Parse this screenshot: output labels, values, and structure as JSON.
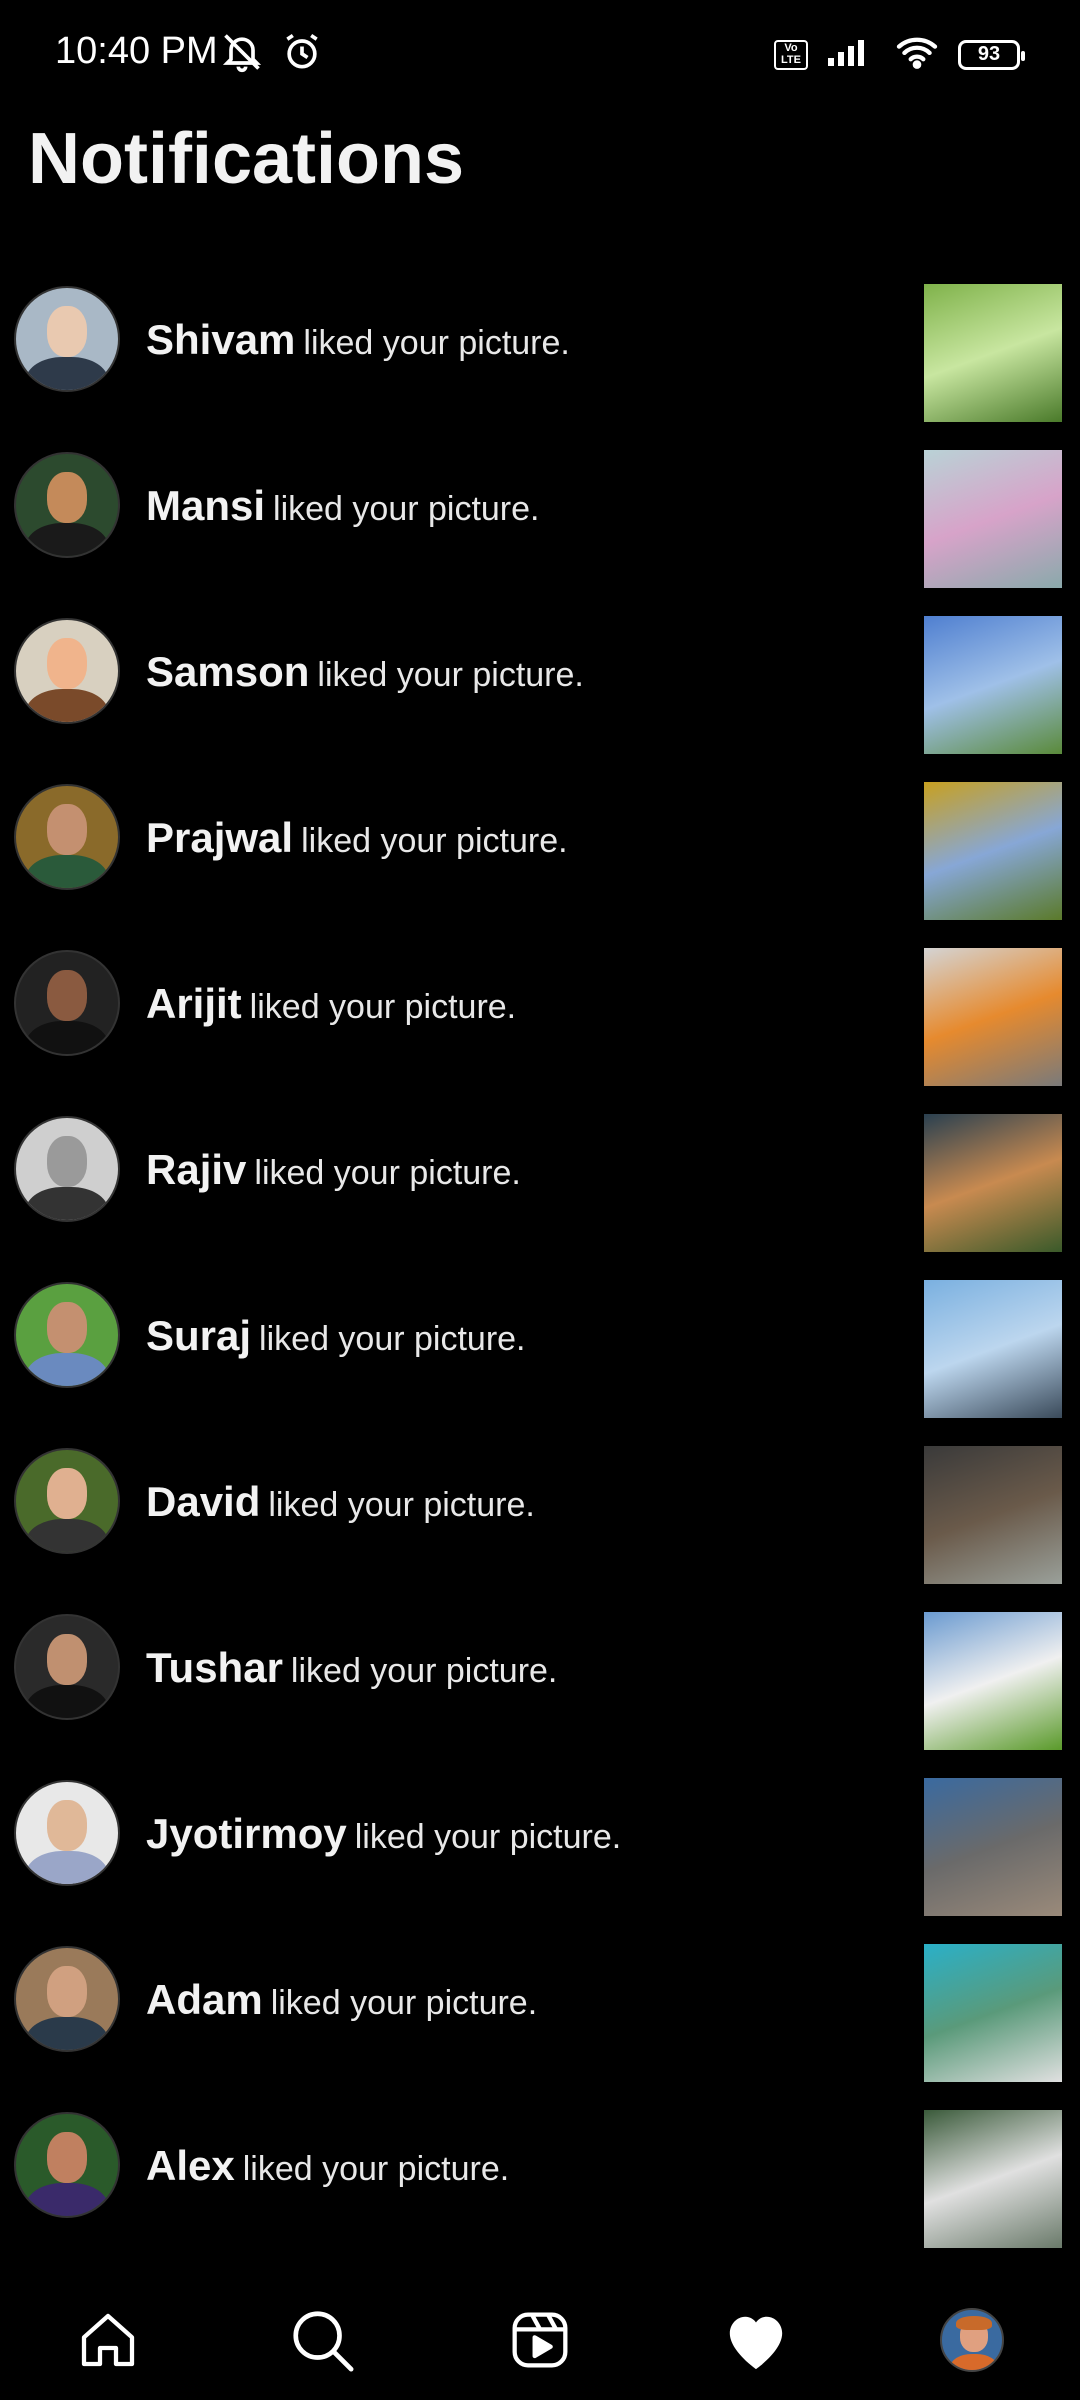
{
  "status_bar": {
    "time": "10:40 PM",
    "icons": [
      "bell-mute-icon",
      "alarm-icon"
    ],
    "right_icons": [
      "volte-icon",
      "signal-icon",
      "wifi-icon"
    ],
    "volte_label": "Vo LTE",
    "battery_level": "93"
  },
  "page": {
    "title": "Notifications"
  },
  "notification_suffix": "liked your picture.",
  "notifications": [
    {
      "name": "Shivam",
      "text": "liked your picture.",
      "avatar_colors": [
        "#a9b8c6",
        "#2e3a4a",
        "#e9c9b0"
      ],
      "thumb_colors": [
        "#7fb24a",
        "#c8e6a0",
        "#4a7a2a"
      ]
    },
    {
      "name": "Mansi",
      "text": "liked your picture.",
      "avatar_colors": [
        "#2c4a2e",
        "#1a1a1a",
        "#c48a5a"
      ],
      "thumb_colors": [
        "#b9d2d6",
        "#d7a3c9",
        "#8aa9ab"
      ]
    },
    {
      "name": "Samson",
      "text": "liked your picture.",
      "avatar_colors": [
        "#d8d0c0",
        "#7a4a2a",
        "#f0b48c"
      ],
      "thumb_colors": [
        "#4f7fd0",
        "#9fc0e8",
        "#5a8a3a"
      ]
    },
    {
      "name": "Prajwal",
      "text": "liked your picture.",
      "avatar_colors": [
        "#8a6a2a",
        "#2a5a3a",
        "#c49070"
      ],
      "thumb_colors": [
        "#c8a020",
        "#87a7d6",
        "#5b7a2a"
      ]
    },
    {
      "name": "Arijit",
      "text": "liked your picture.",
      "avatar_colors": [
        "#222",
        "#111",
        "#8a5a40"
      ],
      "thumb_colors": [
        "#d4d4d4",
        "#e68a2e",
        "#7a7a7a"
      ]
    },
    {
      "name": "Rajiv",
      "text": "liked your picture.",
      "avatar_colors": [
        "#cfcfcf",
        "#333",
        "#9a9a9a"
      ],
      "thumb_colors": [
        "#2a4050",
        "#c88a50",
        "#3a5a2a"
      ]
    },
    {
      "name": "Suraj",
      "text": "liked your picture.",
      "avatar_colors": [
        "#5aa040",
        "#6a8abf",
        "#c49070"
      ],
      "thumb_colors": [
        "#7ab0e0",
        "#bcd6ee",
        "#3a4a5a"
      ]
    },
    {
      "name": "David",
      "text": "liked your picture.",
      "avatar_colors": [
        "#4a6a2a",
        "#333",
        "#e0b090"
      ],
      "thumb_colors": [
        "#3a3a3a",
        "#6a5a4a",
        "#9aa09a"
      ]
    },
    {
      "name": "Tushar",
      "text": "liked your picture.",
      "avatar_colors": [
        "#2a2a2a",
        "#111",
        "#c09070"
      ],
      "thumb_colors": [
        "#6a9ad0",
        "#f0f0f0",
        "#5a9a2a"
      ]
    },
    {
      "name": "Jyotirmoy",
      "text": "liked your picture.",
      "avatar_colors": [
        "#e8e8e8",
        "#9aa6c8",
        "#e0b898"
      ],
      "thumb_colors": [
        "#3a6aa0",
        "#6a6a6a",
        "#9a8a7a"
      ]
    },
    {
      "name": "Adam",
      "text": "liked your picture.",
      "avatar_colors": [
        "#9a7a5a",
        "#2a3a4a",
        "#d0a080"
      ],
      "thumb_colors": [
        "#2ab0c8",
        "#5a9a7a",
        "#e0e0e0"
      ]
    },
    {
      "name": "Alex",
      "text": "liked your picture.",
      "avatar_colors": [
        "#2a5a2a",
        "#3a2a6a",
        "#c08060"
      ],
      "thumb_colors": [
        "#3a5a3a",
        "#e0e0e0",
        "#6a7a6a"
      ]
    }
  ],
  "nav": {
    "items": [
      "home-icon",
      "search-icon",
      "reels-icon",
      "heart-icon",
      "profile-avatar"
    ],
    "active": "heart-icon"
  }
}
